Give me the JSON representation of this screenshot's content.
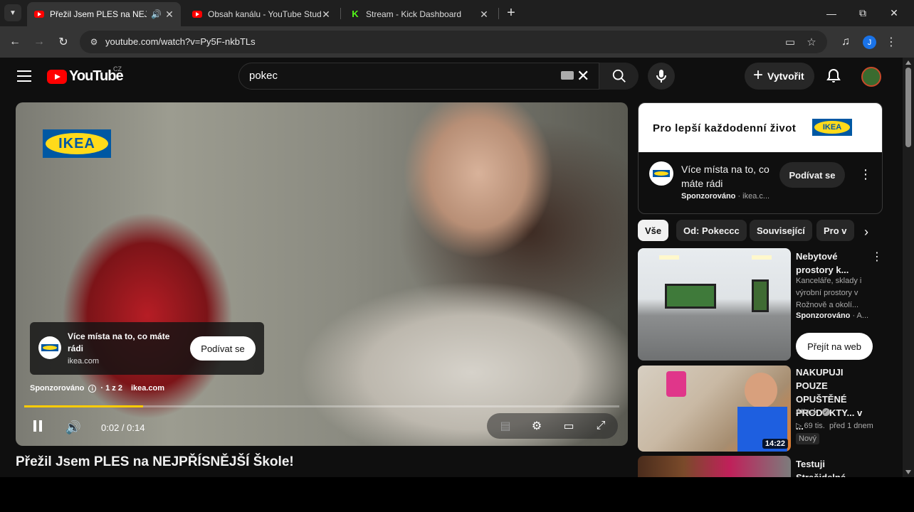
{
  "browser": {
    "tabs": [
      {
        "title": "Přežil Jsem PLES na NEJPŘÍSNĚJŠÍ",
        "favicon": "youtube-icon",
        "active": true,
        "audio": true
      },
      {
        "title": "Obsah kanálu - YouTube Studio",
        "favicon": "youtube-icon",
        "active": false
      },
      {
        "title": "Stream - Kick Dashboard",
        "favicon": "kick-icon",
        "active": false
      }
    ],
    "url": "youtube.com/watch?v=Py5F-nkbTLs",
    "profile_initial": "J"
  },
  "youtube": {
    "logo_text": "YouTube",
    "country_code": "CZ",
    "search_query": "pokec",
    "create_label": "Vytvořit"
  },
  "player": {
    "brand_logo": "IKEA",
    "ad_overlay": {
      "text": "Více místa na to, co máte rádi",
      "domain": "ikea.com",
      "button": "Podívat se"
    },
    "sponsor_label": "Sponzorováno",
    "ad_count": "· 1 z 2",
    "sponsor_domain": "ikea.com",
    "time": "0:02 / 0:14",
    "progress": 0.2
  },
  "video_title": "Přežil Jsem PLES na NEJPŘÍSNĚJŠÍ Škole!",
  "side_ad": {
    "banner_text": "Pro lepší každodenní život",
    "logo": "IKEA",
    "title": "Více místa na to, co máte rádi",
    "sponsored": "Sponzorováno",
    "domain": "· ikea.c...",
    "button": "Podívat se"
  },
  "chips": [
    "Vše",
    "Od: Pokeccc",
    "Související",
    "Pro v"
  ],
  "recommendations": [
    {
      "title": "Nebytové prostory k...",
      "desc": "Kanceláře, sklady i výrobní prostory v Rožnově a okolí...",
      "meta_sponsored": "Sponzorováno",
      "meta_extra": " · A...",
      "button": "Přejít na web"
    },
    {
      "title": "NAKUPUJI POUZE OPUŠTĚNÉ PRODUKTY... v ...",
      "channel": "Attack",
      "views": "▷ 69 tis.",
      "age": "před 1 dnem",
      "badge": "Nový",
      "duration": "14:22"
    },
    {
      "title": "Testuji Strašidelné Minecraft Lži Co..."
    }
  ],
  "colors": {
    "yt_red": "#ff0000",
    "progress_yellow": "#ffcc00",
    "ikea_blue": "#0058a3",
    "ikea_yellow": "#ffda1a",
    "kick_green": "#53fc18"
  }
}
